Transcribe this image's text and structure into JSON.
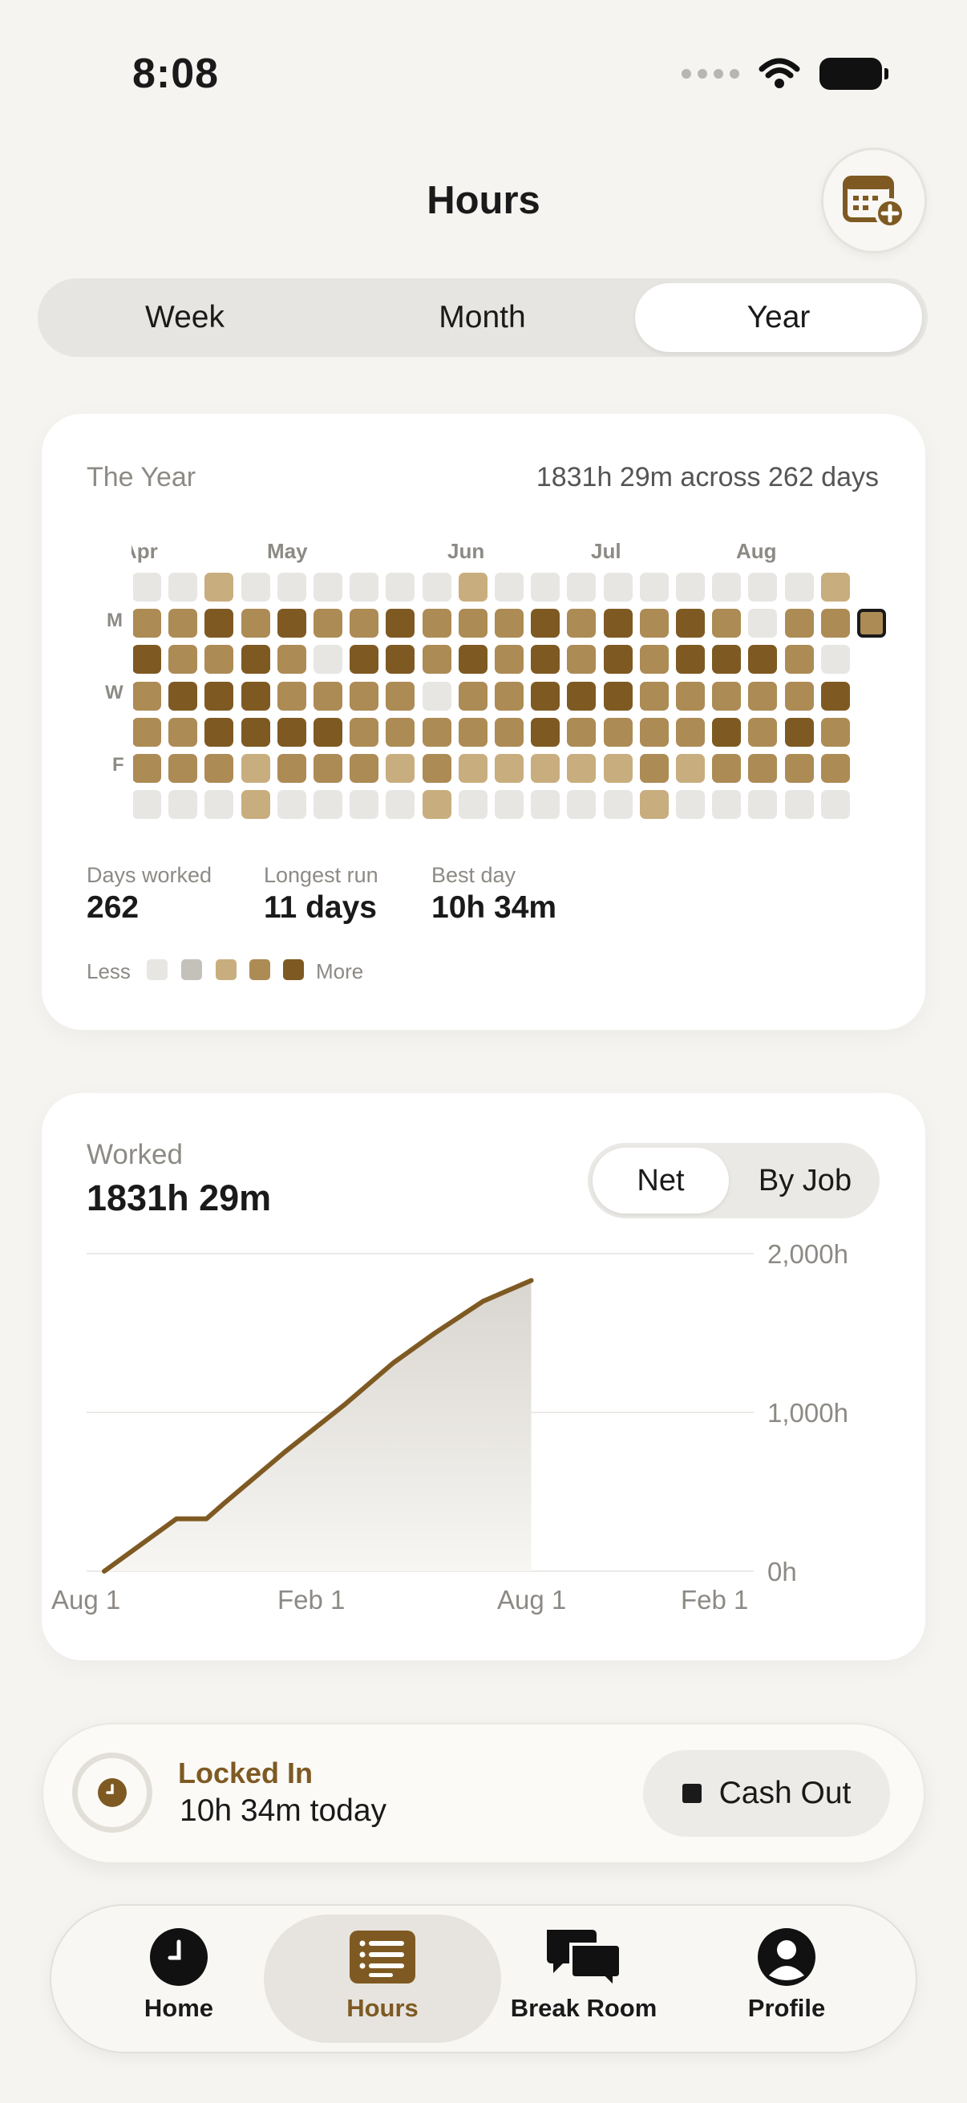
{
  "status_bar": {
    "time": "8:08"
  },
  "header": {
    "title": "Hours"
  },
  "segments": [
    "Week",
    "Month",
    "Year"
  ],
  "year_card": {
    "label": "The Year",
    "summary": "1831h 29m across 262 days",
    "months": [
      "Apr",
      "May",
      "Jun",
      "Jul",
      "Aug"
    ],
    "day_labels": [
      "M",
      "W",
      "F"
    ],
    "grid_rows": [
      "00100000010000000001",
      "22323223222323232022",
      "32232033232323233320",
      "23332222022333222223",
      "22333322222322223232",
      "22212221211111212222",
      "00010000100000100000"
    ],
    "stats": [
      {
        "label": "Days worked",
        "value": "262"
      },
      {
        "label": "Longest run",
        "value": "11 days"
      },
      {
        "label": "Best day",
        "value": "10h 34m"
      }
    ],
    "legend": {
      "less": "Less",
      "more": "More"
    }
  },
  "worked_card": {
    "label": "Worked",
    "value": "1831h 29m",
    "toggle": [
      "Net",
      "By Job"
    ],
    "y_ticks": [
      "2,000h",
      "1,000h",
      "0h"
    ],
    "x_ticks": [
      "Aug 1",
      "Feb 1",
      "Aug 1",
      "Feb 1"
    ]
  },
  "chart_data": {
    "type": "area",
    "title": "",
    "ylabel": "",
    "ylim": [
      0,
      2000
    ],
    "x_ticks": [
      "Aug 1",
      "Feb 1",
      "Aug 1",
      "Feb 1"
    ],
    "series": [
      {
        "x_fraction_of_span": [
          0.0,
          0.12,
          0.17,
          0.2,
          0.3,
          0.4,
          0.48,
          0.55,
          0.63,
          0.71
        ],
        "values": [
          0,
          330,
          330,
          430,
          750,
          1050,
          1310,
          1500,
          1700,
          1831
        ]
      }
    ]
  },
  "locked": {
    "title": "Locked In",
    "subtitle": "10h 34m today",
    "button": "Cash Out"
  },
  "tabs": [
    "Home",
    "Hours",
    "Break Room",
    "Profile"
  ],
  "colors": {
    "accent": "#7e5a22",
    "level0": "#e7e6e3",
    "level1": "#c8ae7e",
    "level2": "#ad8b55",
    "level3": "#7e5a22"
  }
}
